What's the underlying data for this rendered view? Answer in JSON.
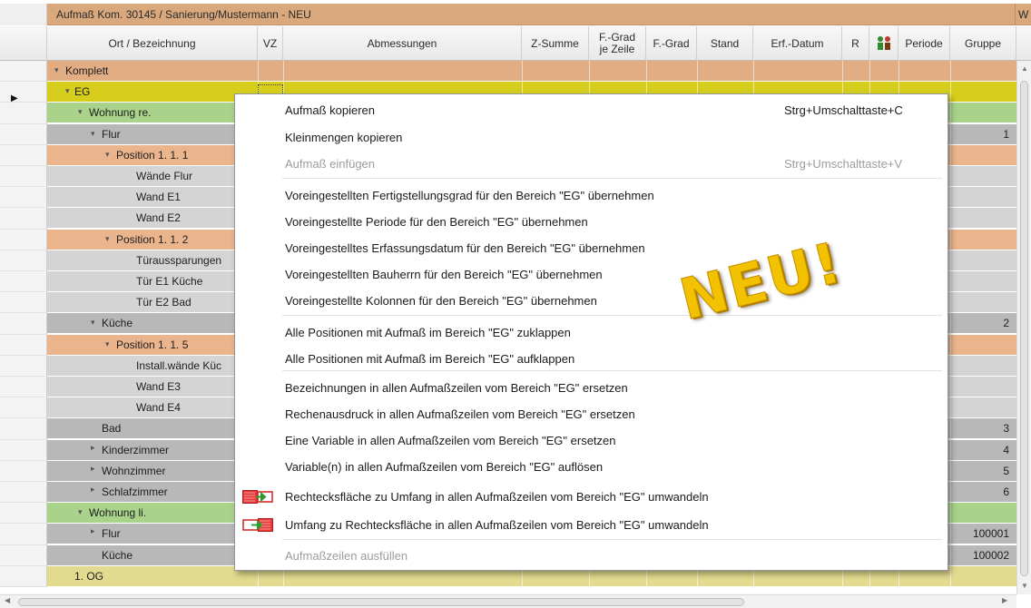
{
  "window": {
    "title": "Aufmaß Kom. 30145 / Sanierung/Mustermann - NEU",
    "title_cut": "W"
  },
  "columns": [
    {
      "key": "ort",
      "label": "Ort / Bezeichnung"
    },
    {
      "key": "vz",
      "label": "VZ"
    },
    {
      "key": "abm",
      "label": "Abmessungen"
    },
    {
      "key": "zsum",
      "label": "Z-Summe"
    },
    {
      "key": "fgz",
      "label": "F.-Grad je Zeile"
    },
    {
      "key": "fg",
      "label": "F.-Grad"
    },
    {
      "key": "stand",
      "label": "Stand"
    },
    {
      "key": "erf",
      "label": "Erf.-Datum"
    },
    {
      "key": "r",
      "label": "R"
    },
    {
      "key": "icon",
      "label": "",
      "icon": "people-icon"
    },
    {
      "key": "periode",
      "label": "Periode"
    },
    {
      "key": "gruppe",
      "label": "Gruppe"
    }
  ],
  "rows": [
    {
      "label": "Komplett",
      "expander": "expanded",
      "gruppe": ""
    },
    {
      "label": "EG",
      "expander": "expanded",
      "gruppe": ""
    },
    {
      "label": "Wohnung re.",
      "expander": "expanded",
      "gruppe": ""
    },
    {
      "label": "Flur",
      "expander": "expanded",
      "gruppe": "1"
    },
    {
      "label": "Position  1. 1.  1",
      "expander": "expanded",
      "gruppe": ""
    },
    {
      "label": "Wände Flur",
      "expander": "",
      "gruppe": ""
    },
    {
      "label": "Wand E1",
      "expander": "",
      "gruppe": ""
    },
    {
      "label": "Wand E2",
      "expander": "",
      "gruppe": ""
    },
    {
      "label": "Position  1. 1.  2",
      "expander": "expanded",
      "gruppe": ""
    },
    {
      "label": "Türaussparungen",
      "expander": "",
      "gruppe": ""
    },
    {
      "label": "Tür E1 Küche",
      "expander": "",
      "gruppe": ""
    },
    {
      "label": "Tür E2 Bad",
      "expander": "",
      "gruppe": ""
    },
    {
      "label": "Küche",
      "expander": "expanded",
      "gruppe": "2"
    },
    {
      "label": "Position  1. 1.  5",
      "expander": "expanded",
      "gruppe": ""
    },
    {
      "label": "Install.wände Küc",
      "expander": "",
      "gruppe": ""
    },
    {
      "label": "Wand E3",
      "expander": "",
      "gruppe": ""
    },
    {
      "label": "Wand E4",
      "expander": "",
      "gruppe": ""
    },
    {
      "label": "Bad",
      "expander": "",
      "gruppe": "3"
    },
    {
      "label": "Kinderzimmer",
      "expander": "collapsed",
      "gruppe": "4"
    },
    {
      "label": "Wohnzimmer",
      "expander": "collapsed",
      "gruppe": "5"
    },
    {
      "label": "Schlafzimmer",
      "expander": "collapsed",
      "gruppe": "6"
    },
    {
      "label": "Wohnung li.",
      "expander": "expanded",
      "gruppe": ""
    },
    {
      "label": "Flur",
      "expander": "collapsed",
      "gruppe": "100001"
    },
    {
      "label": "Küche",
      "expander": "",
      "gruppe": "100002"
    },
    {
      "label": "1. OG",
      "expander": "",
      "gruppe": ""
    }
  ],
  "context_menu": {
    "items": [
      {
        "label": "Aufmaß kopieren",
        "shortcut": "Strg+Umschalttaste+C",
        "disabled": false
      },
      {
        "label": "Kleinmengen kopieren",
        "shortcut": "",
        "disabled": false
      },
      {
        "label": "Aufmaß einfügen",
        "shortcut": "Strg+Umschalttaste+V",
        "disabled": true
      },
      {
        "label": "Voreingestellten Fertigstellungsgrad für den Bereich \"EG\" übernehmen",
        "shortcut": "",
        "disabled": false
      },
      {
        "label": "Voreingestellte Periode für den Bereich \"EG\" übernehmen",
        "shortcut": "",
        "disabled": false
      },
      {
        "label": "Voreingestelltes Erfassungsdatum für den Bereich \"EG\" übernehmen",
        "shortcut": "",
        "disabled": false
      },
      {
        "label": "Voreingestellten Bauherrn für den Bereich \"EG\" übernehmen",
        "shortcut": "",
        "disabled": false
      },
      {
        "label": "Voreingestellte Kolonnen für den Bereich \"EG\" übernehmen",
        "shortcut": "",
        "disabled": false
      },
      {
        "label": "Alle Positionen mit Aufmaß im Bereich \"EG\" zuklappen",
        "shortcut": "",
        "disabled": false
      },
      {
        "label": "Alle Positionen mit Aufmaß im Bereich \"EG\" aufklappen",
        "shortcut": "",
        "disabled": false
      },
      {
        "label": "Bezeichnungen in allen Aufmaßzeilen vom Bereich \"EG\" ersetzen",
        "shortcut": "",
        "disabled": false
      },
      {
        "label": "Rechenausdruck in allen Aufmaßzeilen vom Bereich \"EG\" ersetzen",
        "shortcut": "",
        "disabled": false
      },
      {
        "label": "Eine Variable in allen Aufmaßzeilen vom Bereich \"EG\" ersetzen",
        "shortcut": "",
        "disabled": false
      },
      {
        "label": "Variable(n) in allen Aufmaßzeilen vom Bereich \"EG\" auflösen",
        "shortcut": "",
        "disabled": false
      },
      {
        "label": "Rechtecksfläche zu Umfang in allen Aufmaßzeilen vom Bereich \"EG\" umwandeln",
        "shortcut": "",
        "disabled": false,
        "icon": "rect-to-perimeter-icon"
      },
      {
        "label": "Umfang zu Rechtecksfläche in allen Aufmaßzeilen vom Bereich \"EG\" umwandeln",
        "shortcut": "",
        "disabled": false,
        "icon": "perimeter-to-rect-icon"
      },
      {
        "label": "Aufmaßzeilen ausfüllen",
        "shortcut": "",
        "disabled": true
      }
    ]
  },
  "badge": {
    "text": "NEU!"
  },
  "colors": {
    "title": "#d9a97d",
    "komplett": "#e3ad84",
    "eg": "#d6cd1c",
    "wohnung": "#a9d38b",
    "raum": "#b8b8b8",
    "position": "#eab58d",
    "leaf": "#d4d4d4",
    "og": "#e2db8f",
    "badge": "#f2c200"
  }
}
